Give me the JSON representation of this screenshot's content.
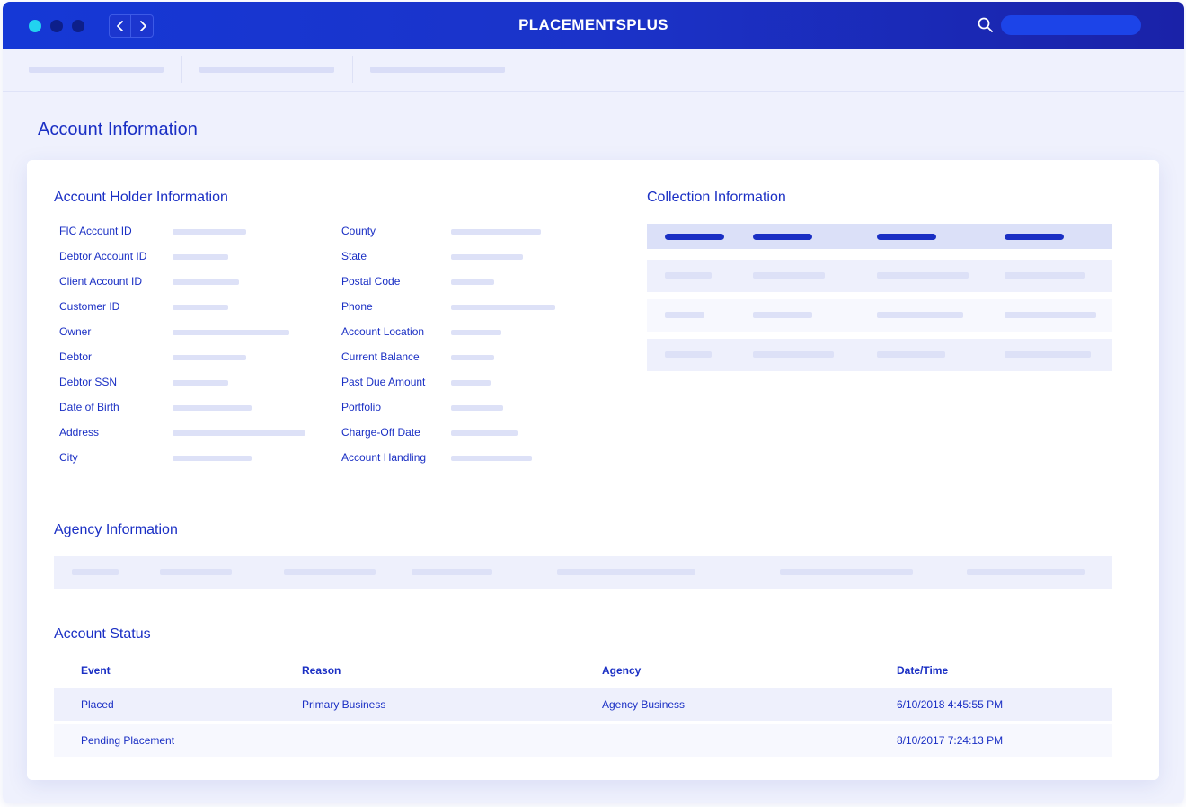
{
  "app": {
    "title": "PLACEMENTSPLUS",
    "search_value": ""
  },
  "page": {
    "title": "Account Information"
  },
  "account_holder": {
    "title": "Account Holder Information",
    "left_fields": [
      "FIC Account ID",
      "Debtor Account ID",
      "Client Account ID",
      "Customer ID",
      "Owner",
      "Debtor",
      "Debtor SSN",
      "Date of Birth",
      "Address",
      "City"
    ],
    "right_fields": [
      "County",
      "State",
      "Postal Code",
      "Phone",
      "Account Location",
      "Current Balance",
      "Past Due Amount",
      "Portfolio",
      "Charge-Off Date",
      "Account Handling"
    ]
  },
  "collection": {
    "title": "Collection Information"
  },
  "agency": {
    "title": "Agency Information"
  },
  "status": {
    "title": "Account Status",
    "headers": {
      "event": "Event",
      "reason": "Reason",
      "agency": "Agency",
      "datetime": "Date/Time"
    },
    "rows": [
      {
        "event": "Placed",
        "reason": "Primary Business",
        "agency": "Agency Business",
        "datetime": "6/10/2018 4:45:55 PM"
      },
      {
        "event": "Pending Placement",
        "reason": "",
        "agency": "",
        "datetime": "8/10/2017 7:24:13 PM"
      }
    ]
  },
  "colors": {
    "accent": "#1a2fc4",
    "titlebar": "#1b33c9",
    "background": "#eff1fd",
    "placeholder": "#dde1f7"
  }
}
